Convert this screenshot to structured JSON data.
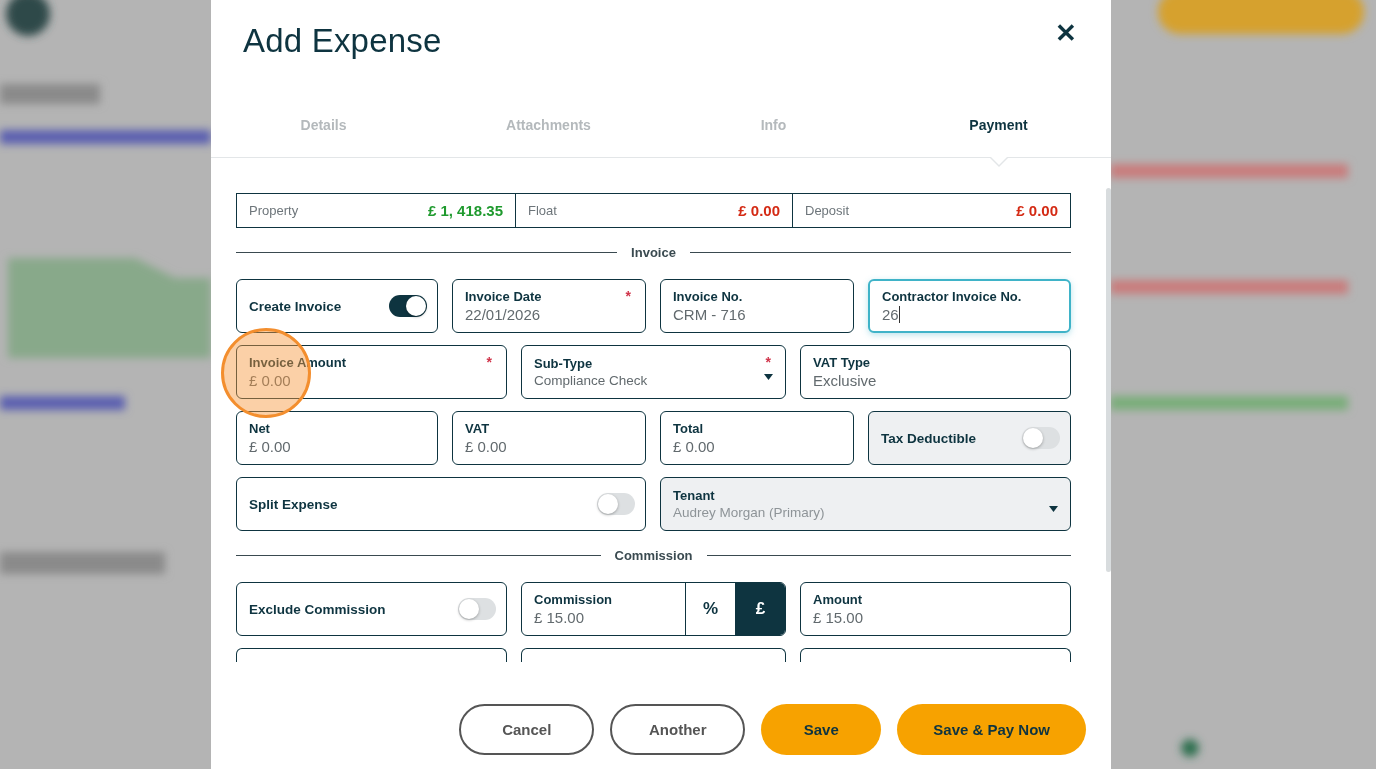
{
  "dialog": {
    "title": "Add Expense",
    "close": "✕"
  },
  "tabs": [
    {
      "label": "Details",
      "selected": false
    },
    {
      "label": "Attachments",
      "selected": false
    },
    {
      "label": "Info",
      "selected": false
    },
    {
      "label": "Payment",
      "selected": true
    }
  ],
  "balances": [
    {
      "label": "Property",
      "value": "£ 1, 418.35",
      "color": "#1f9a2e"
    },
    {
      "label": "Float",
      "value": "£ 0.00",
      "color": "#d42a14"
    },
    {
      "label": "Deposit",
      "value": "£ 0.00",
      "color": "#d42a14"
    }
  ],
  "sections": [
    {
      "title": "Invoice",
      "rows": [
        [
          {
            "kind": "toggle",
            "label": "Create Invoice",
            "on": true,
            "disabled": false
          },
          {
            "kind": "input",
            "label": "Invoice Date",
            "value": "22/01/2026",
            "required_mark": "*",
            "focused": false,
            "disabled": false
          },
          {
            "kind": "input",
            "label": "Invoice No.",
            "value": "CRM - 716",
            "focused": false,
            "disabled": false
          },
          {
            "kind": "input",
            "label": "Contractor Invoice No.",
            "value": "26",
            "focused": true,
            "disabled": false
          }
        ],
        [
          {
            "kind": "input",
            "label": "Invoice Amount",
            "placeholder": "£ 0.00",
            "required_mark": "*",
            "focused": false,
            "disabled": false
          },
          {
            "kind": "select",
            "label": "Sub-Type",
            "value": "Compliance Check",
            "required_mark": "*",
            "disabled": false
          },
          {
            "kind": "input",
            "label": "VAT Type",
            "value": "Exclusive",
            "focused": false,
            "disabled": false
          }
        ],
        [
          {
            "kind": "input",
            "label": "Net",
            "value": "£ 0.00",
            "focused": false,
            "disabled": false
          },
          {
            "kind": "input",
            "label": "VAT",
            "value": "£ 0.00",
            "focused": false,
            "disabled": false
          },
          {
            "kind": "input",
            "label": "Total",
            "value": "£ 0.00",
            "focused": false,
            "disabled": false
          },
          {
            "kind": "toggle",
            "label": "Tax Deductible",
            "on": false,
            "disabled": true
          }
        ],
        [
          {
            "kind": "toggle",
            "label": "Split Expense",
            "on": false,
            "disabled": false
          },
          {
            "kind": "select",
            "label": "Tenant",
            "value": "Audrey Morgan (Primary)",
            "disabled": true
          }
        ]
      ]
    },
    {
      "title": "Commission",
      "rows": [
        [
          {
            "kind": "toggle",
            "label": "Exclude Commission",
            "on": false,
            "disabled": false
          },
          {
            "kind": "unit-input",
            "label": "Commission",
            "value": "£ 15.00",
            "units": [
              {
                "label": "%",
                "selected": false
              },
              {
                "label": "£",
                "selected": true
              }
            ]
          },
          {
            "kind": "input",
            "label": "Amount",
            "value": "£ 15.00",
            "focused": false,
            "disabled": false
          }
        ],
        [
          {
            "kind": "blank"
          },
          {
            "kind": "blank"
          },
          {
            "kind": "blank"
          }
        ]
      ]
    }
  ],
  "buttons": [
    {
      "label": "Cancel",
      "kind": "outline"
    },
    {
      "label": "Another",
      "kind": "outline"
    },
    {
      "label": "Save",
      "kind": "primary"
    },
    {
      "label": "Save & Pay Now",
      "kind": "primary"
    }
  ]
}
